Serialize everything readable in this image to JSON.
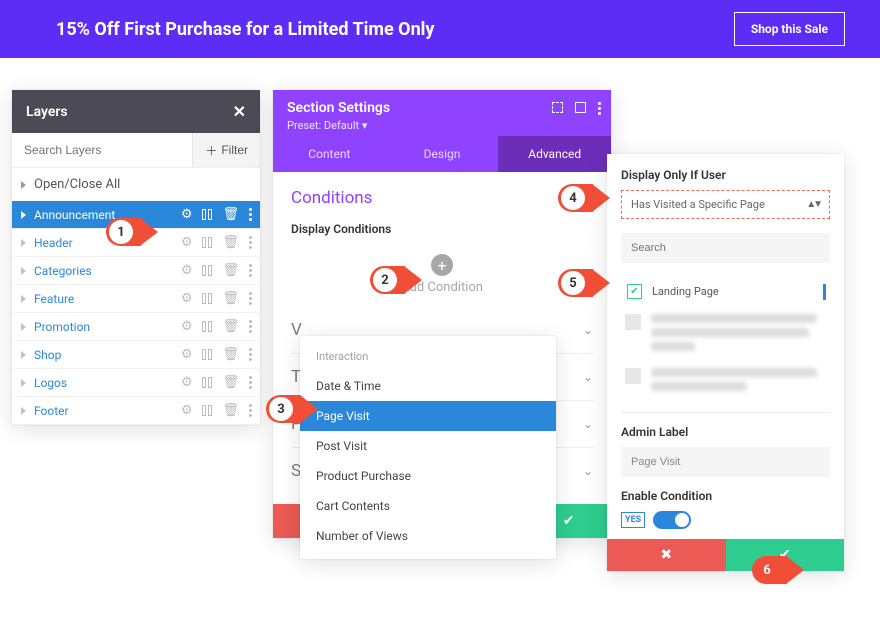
{
  "promo": {
    "text": "15% Off First Purchase for a Limited Time Only",
    "button": "Shop this Sale"
  },
  "layers": {
    "title": "Layers",
    "search_placeholder": "Search Layers",
    "filter": "Filter",
    "open_close": "Open/Close All",
    "items": [
      {
        "label": "Announcement",
        "selected": true
      },
      {
        "label": "Header",
        "selected": false
      },
      {
        "label": "Categories",
        "selected": false
      },
      {
        "label": "Feature",
        "selected": false
      },
      {
        "label": "Promotion",
        "selected": false
      },
      {
        "label": "Shop",
        "selected": false
      },
      {
        "label": "Logos",
        "selected": false
      },
      {
        "label": "Footer",
        "selected": false
      }
    ]
  },
  "section": {
    "title": "Section Settings",
    "preset": "Preset: Default ▾",
    "tabs": {
      "content": "Content",
      "design": "Design",
      "advanced": "Advanced"
    },
    "conditions": "Conditions",
    "display_conditions": "Display Conditions",
    "add_condition": "Add Condition",
    "faded": {
      "v": "V",
      "t": "T",
      "p": "P",
      "scroll": "Scroll Effects"
    }
  },
  "dropdown": {
    "heading": "Interaction",
    "items": [
      {
        "label": "Date & Time"
      },
      {
        "label": "Page Visit",
        "selected": true
      },
      {
        "label": "Post Visit"
      },
      {
        "label": "Product Purchase"
      },
      {
        "label": "Cart Contents"
      },
      {
        "label": "Number of Views"
      }
    ]
  },
  "cond": {
    "display_only": "Display Only If User",
    "select_value": "Has Visited a Specific Page",
    "search_placeholder": "Search",
    "landing_page": "Landing Page",
    "admin_label": "Admin Label",
    "admin_value": "Page Visit",
    "enable": "Enable Condition",
    "yes": "YES"
  },
  "callouts": {
    "1": "1",
    "2": "2",
    "3": "3",
    "4": "4",
    "5": "5",
    "6": "6"
  }
}
